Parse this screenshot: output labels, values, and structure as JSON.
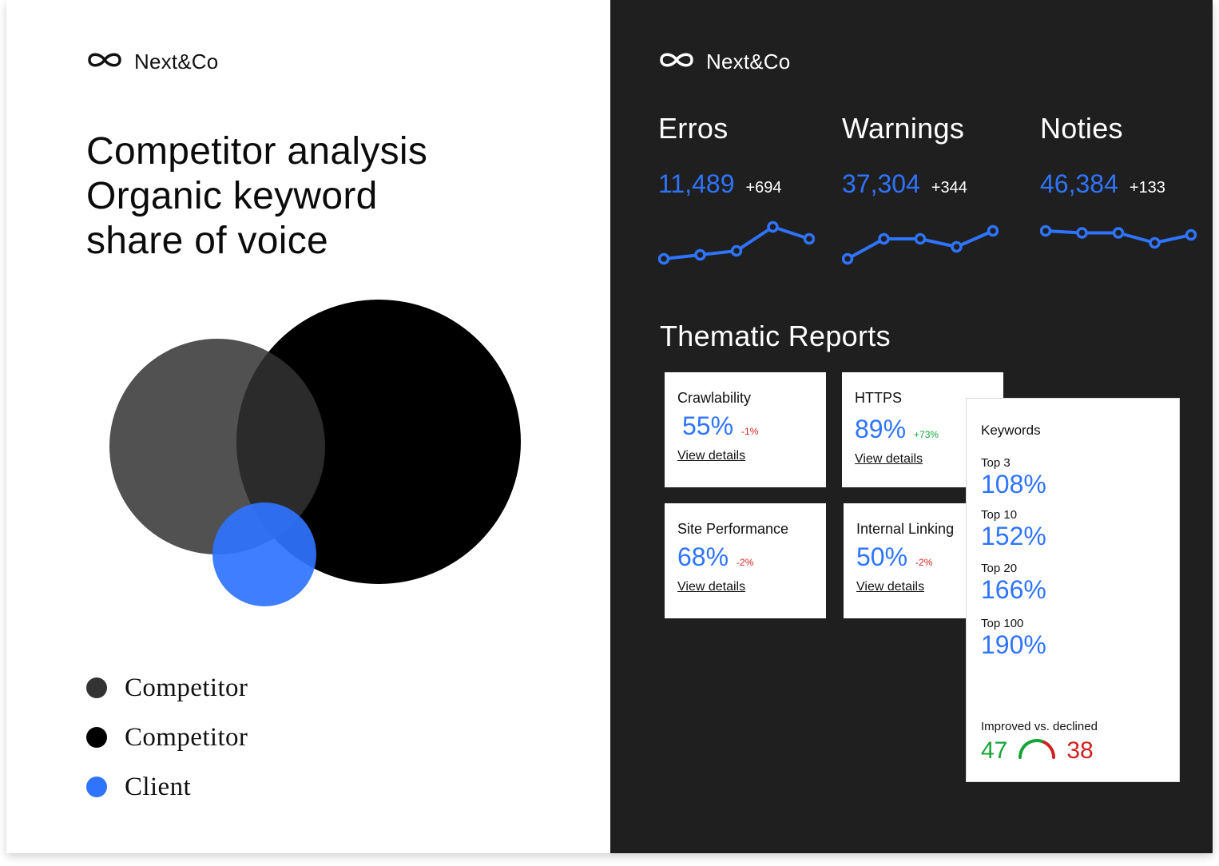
{
  "brand": {
    "name": "Next&Co"
  },
  "left": {
    "headline": [
      "Competitor analysis",
      "Organic keyword",
      "share of voice"
    ],
    "legend": [
      {
        "label": "Competitor",
        "color": "#333333"
      },
      {
        "label": "Competitor",
        "color": "#000000"
      },
      {
        "label": "Client",
        "color": "#2f74ff"
      }
    ]
  },
  "metrics": [
    {
      "title": "Erros",
      "value": "11,489",
      "delta": "+694",
      "trend": [
        1,
        2,
        3,
        9,
        6
      ]
    },
    {
      "title": "Warnings",
      "value": "37,304",
      "delta": "+344",
      "trend": [
        1,
        6,
        6,
        4,
        8
      ]
    },
    {
      "title": "Noties",
      "value": "46,384",
      "delta": "+133",
      "trend": [
        8,
        7.5,
        7.5,
        5,
        7
      ]
    }
  ],
  "thematic": {
    "title": "Thematic Reports",
    "link_label": "View details",
    "cards": [
      {
        "title": "Crawlability",
        "value": "55%",
        "delta": "-1%",
        "trend": "down"
      },
      {
        "title": "HTTPS",
        "value": "89%",
        "delta": "+73%",
        "trend": "up"
      },
      {
        "title": "Site Performance",
        "value": "68%",
        "delta": "-2%",
        "trend": "down"
      },
      {
        "title": "Internal Linking",
        "value": "50%",
        "delta": "-2%",
        "trend": "down"
      }
    ]
  },
  "keywords": {
    "title": "Keywords",
    "rows": [
      {
        "label": "Top 3",
        "value": "108%"
      },
      {
        "label": "Top 10",
        "value": "152%"
      },
      {
        "label": "Top 20",
        "value": "166%"
      },
      {
        "label": "Top 100",
        "value": "190%"
      }
    ],
    "improved_label": "Improved vs. declined",
    "improved": "47",
    "declined": "38"
  },
  "colors": {
    "accent": "#2f74ff",
    "dark": "#1f1f1f",
    "up": "#13a538",
    "down": "#d21f1f"
  }
}
